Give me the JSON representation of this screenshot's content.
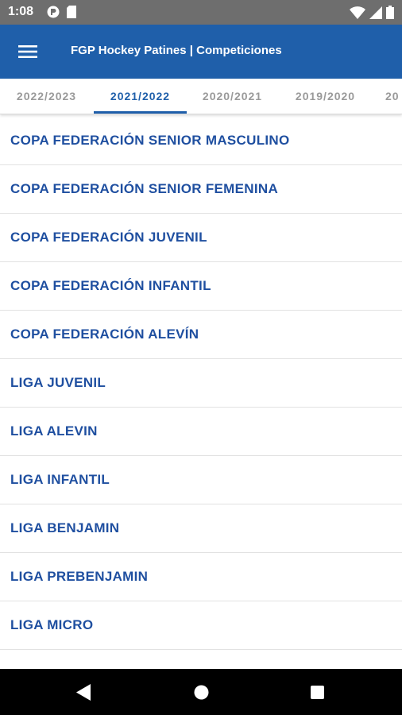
{
  "status_bar": {
    "time": "1:08",
    "icons": [
      "data-saver-icon",
      "sd-card-icon",
      "wifi-icon",
      "signal-icon",
      "battery-icon"
    ]
  },
  "app_bar": {
    "title": "FGP Hockey Patines | Competiciones",
    "menu_icon": "hamburger-menu-icon",
    "color": "#1f5faa"
  },
  "tabs": [
    {
      "label": "2022/2023",
      "active": false
    },
    {
      "label": "2021/2022",
      "active": true
    },
    {
      "label": "2020/2021",
      "active": false
    },
    {
      "label": "2019/2020",
      "active": false
    },
    {
      "label": "20",
      "active": false
    }
  ],
  "competitions": [
    "COPA FEDERACIÓN SENIOR MASCULINO",
    "COPA FEDERACIÓN SENIOR FEMENINA",
    "COPA FEDERACIÓN JUVENIL",
    "COPA FEDERACIÓN INFANTIL",
    "COPA FEDERACIÓN ALEVÍN",
    "LIGA JUVENIL",
    "LIGA ALEVIN",
    "LIGA INFANTIL",
    "LIGA BENJAMIN",
    "LIGA PREBENJAMIN",
    "LIGA MICRO"
  ],
  "colors": {
    "accent": "#1f5faa",
    "item_text": "#1f4fa0",
    "tab_inactive": "#9a9a9a"
  },
  "nav_bar": {
    "icons": [
      "back-icon",
      "home-icon",
      "recents-icon"
    ]
  }
}
